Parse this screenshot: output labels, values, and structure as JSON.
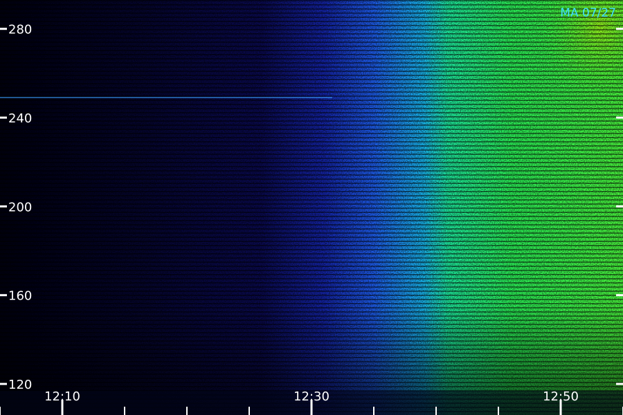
{
  "station_label": "MA 07/27",
  "chart_data": {
    "type": "heatmap",
    "title": "",
    "xlabel": "",
    "ylabel": "",
    "x_tick_labels": [
      "12:10",
      "12:30",
      "12:50"
    ],
    "x_major_ticks": [
      "12:10",
      "12:30",
      "12:50"
    ],
    "x_minor_ticks": [
      "12:05",
      "12:15",
      "12:20",
      "12:25",
      "12:35",
      "12:40",
      "12:45",
      "12:55"
    ],
    "xlim": [
      "12:05",
      "12:55"
    ],
    "y_ticks": [
      120,
      160,
      200,
      240,
      280
    ],
    "ylim": [
      106,
      293
    ],
    "colormap": [
      "#000000",
      "#0a0a5a",
      "#1a2bd0",
      "#1e7bff",
      "#18d8ff",
      "#22ff9a",
      "#2cff40",
      "#b4ff10"
    ],
    "intensity_regions": [
      {
        "time_start": "12:05",
        "time_end": "12:29",
        "y_min": 120,
        "y_max": 293,
        "level": "low"
      },
      {
        "time_start": "12:29",
        "time_end": "12:39",
        "y_min": 120,
        "y_max": 293,
        "level": "medium"
      },
      {
        "time_start": "12:39",
        "time_end": "12:55",
        "y_min": 140,
        "y_max": 293,
        "level": "high"
      },
      {
        "time_start": "12:39",
        "time_end": "12:55",
        "y_min": 120,
        "y_max": 140,
        "level": "medium"
      }
    ]
  }
}
